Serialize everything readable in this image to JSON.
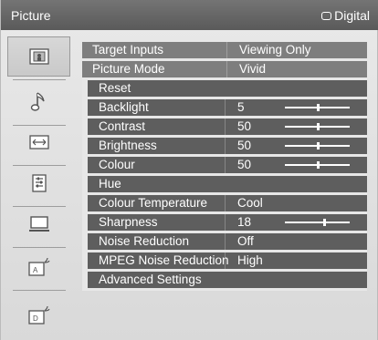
{
  "header": {
    "title": "Picture",
    "source": "Digital"
  },
  "sidebar": {
    "items": [
      {
        "name": "picture",
        "icon": "picture-icon",
        "selected": true
      },
      {
        "name": "sound",
        "icon": "music-note-icon",
        "selected": false
      },
      {
        "name": "screen",
        "icon": "screen-resize-icon",
        "selected": false
      },
      {
        "name": "setup",
        "icon": "list-settings-icon",
        "selected": false
      },
      {
        "name": "pc",
        "icon": "laptop-icon",
        "selected": false
      },
      {
        "name": "analogue-setup",
        "icon": "analogue-antenna-icon",
        "selected": false
      },
      {
        "name": "digital-setup",
        "icon": "digital-antenna-icon",
        "selected": false
      }
    ]
  },
  "menu": {
    "rows": [
      {
        "name": "target-inputs",
        "kind": "main",
        "label": "Target Inputs",
        "value": "Viewing Only"
      },
      {
        "name": "picture-mode",
        "kind": "main",
        "label": "Picture Mode",
        "value": "Vivid"
      },
      {
        "name": "reset",
        "kind": "sub",
        "label": "Reset",
        "value": ""
      },
      {
        "name": "backlight",
        "kind": "sub",
        "label": "Backlight",
        "value": "5",
        "level": 0.5
      },
      {
        "name": "contrast",
        "kind": "sub",
        "label": "Contrast",
        "value": "50",
        "level": 0.5
      },
      {
        "name": "brightness",
        "kind": "sub",
        "label": "Brightness",
        "value": "50",
        "level": 0.5
      },
      {
        "name": "colour",
        "kind": "sub",
        "label": "Colour",
        "value": "50",
        "level": 0.5
      },
      {
        "name": "hue",
        "kind": "sub",
        "label": "Hue",
        "value": ""
      },
      {
        "name": "colour-temperature",
        "kind": "sub",
        "label": "Colour Temperature",
        "value": "Cool"
      },
      {
        "name": "sharpness",
        "kind": "sub",
        "label": "Sharpness",
        "value": "18",
        "level": 0.6
      },
      {
        "name": "noise-reduction",
        "kind": "sub",
        "label": "Noise Reduction",
        "value": "Off"
      },
      {
        "name": "mpeg-noise-reduction",
        "kind": "sub",
        "label": "MPEG Noise Reduction",
        "value": "High"
      },
      {
        "name": "advanced-settings",
        "kind": "sub",
        "label": "Advanced Settings",
        "value": ""
      }
    ]
  },
  "colors": {
    "header_bg": "#646464",
    "main_row": "#7e7e7e",
    "sub_row": "#5e5e5e",
    "panel_bg": "#e7e7e7"
  }
}
